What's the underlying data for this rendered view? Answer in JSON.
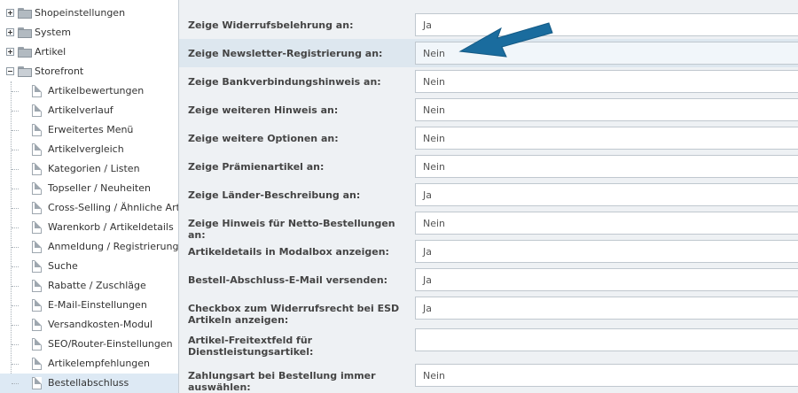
{
  "sidebar": {
    "top_items": [
      {
        "label": "Shopeinstellungen",
        "icon": "folder-icon",
        "expander": "plus"
      },
      {
        "label": "System",
        "icon": "folder-icon",
        "expander": "plus"
      },
      {
        "label": "Artikel",
        "icon": "folder-icon",
        "expander": "plus"
      },
      {
        "label": "Storefront",
        "icon": "folder-open-icon",
        "expander": "minus"
      }
    ],
    "storefront_children": [
      "Artikelbewertungen",
      "Artikelverlauf",
      "Erweitertes Menü",
      "Artikelvergleich",
      "Kategorien / Listen",
      "Topseller / Neuheiten",
      "Cross-Selling / Ähnliche Art.",
      "Warenkorb / Artikeldetails",
      "Anmeldung / Registrierung",
      "Suche",
      "Rabatte / Zuschläge",
      "E-Mail-Einstellungen",
      "Versandkosten-Modul",
      "SEO/Router-Einstellungen",
      "Artikelempfehlungen",
      "Bestellabschluss"
    ],
    "selected": "Bestellabschluss"
  },
  "form": {
    "rows": [
      {
        "label": "Zeige Widerrufsbelehrung an:",
        "value": "Ja"
      },
      {
        "label": "Zeige Newsletter-Registrierung an:",
        "value": "Nein"
      },
      {
        "label": "Zeige Bankverbindungshinweis an:",
        "value": "Nein"
      },
      {
        "label": "Zeige weiteren Hinweis an:",
        "value": "Nein"
      },
      {
        "label": "Zeige weitere Optionen an:",
        "value": "Nein"
      },
      {
        "label": "Zeige Prämienartikel an:",
        "value": "Nein"
      },
      {
        "label": "Zeige Länder-Beschreibung an:",
        "value": "Ja"
      },
      {
        "label": "Zeige Hinweis für Netto-Bestellungen an:",
        "value": "Nein"
      },
      {
        "label": "Artikeldetails in Modalbox anzeigen:",
        "value": "Ja"
      },
      {
        "label": "Bestell-Abschluss-E-Mail versenden:",
        "value": "Ja"
      },
      {
        "label": "Checkbox zum Widerrufsrecht bei ESD Artikeln anzeigen:",
        "value": "Ja"
      },
      {
        "label": "Artikel-Freitextfeld für Dienstleistungsartikel:",
        "value": ""
      },
      {
        "label": "Zahlungsart bei Bestellung immer auswählen:",
        "value": "Nein"
      }
    ],
    "highlighted_row": "Zeige Newsletter-Registrierung an:"
  },
  "annotation": {
    "arrow_color": "#1a6c9e",
    "points_to": "Zeige Newsletter-Registrierung an:"
  }
}
